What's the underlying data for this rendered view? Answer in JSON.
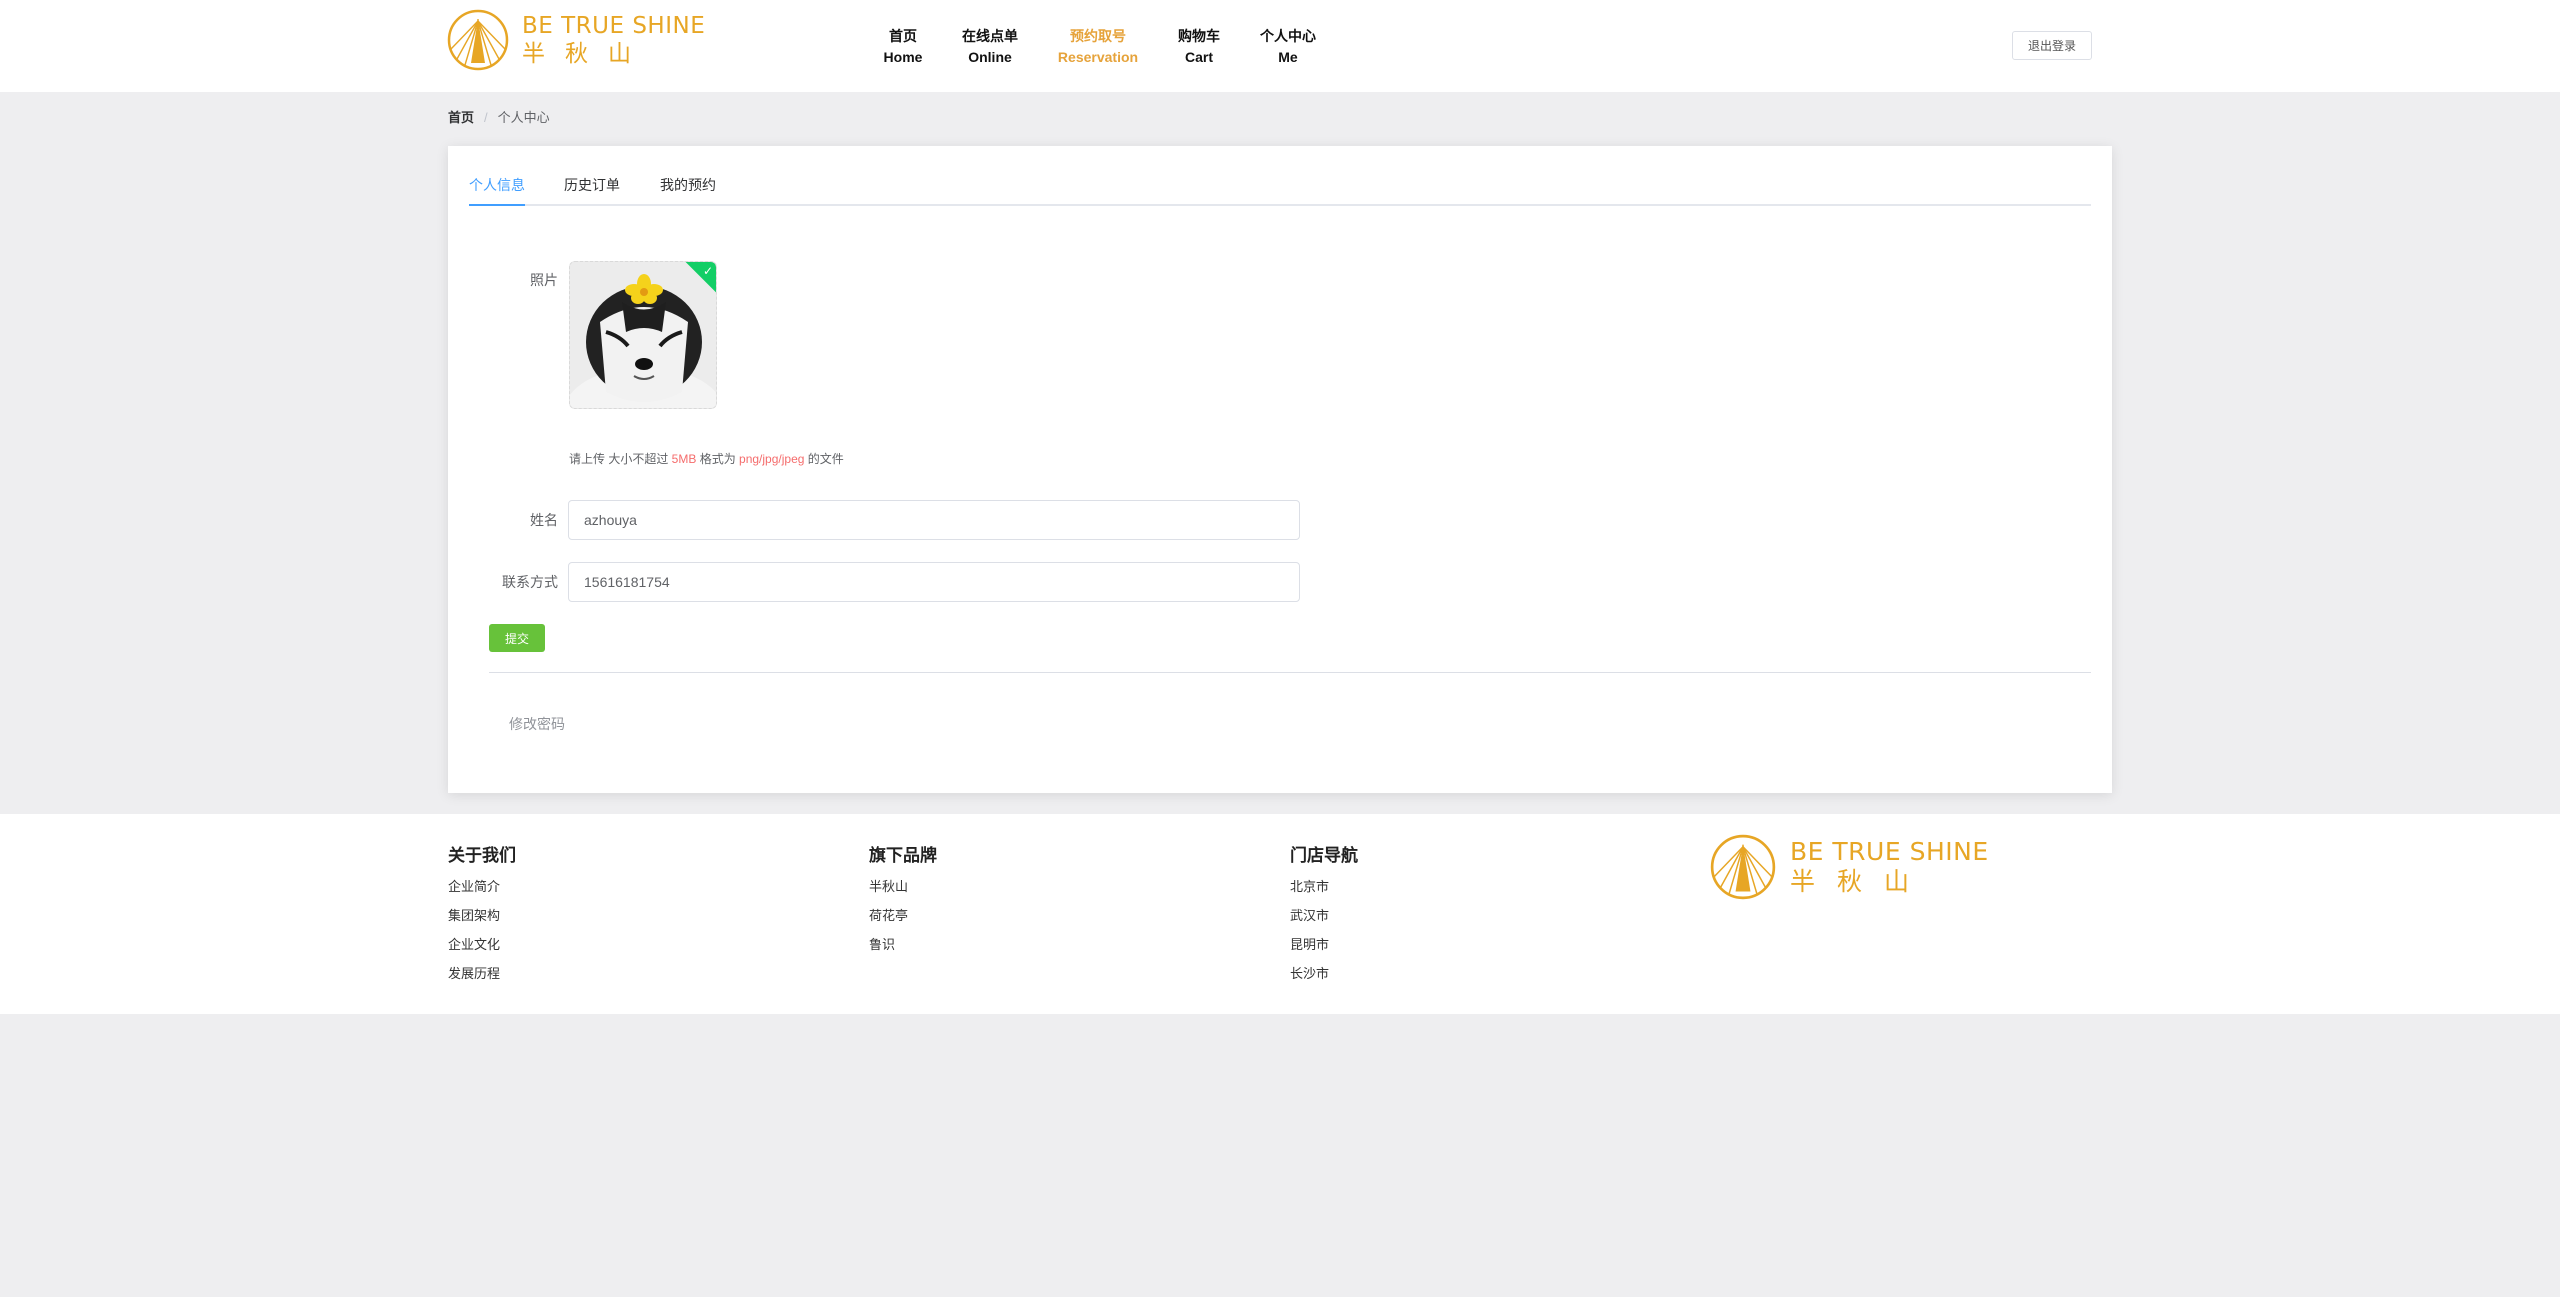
{
  "brand": {
    "name_en": "BE TRUE SHINE",
    "name_cn": "半秋山",
    "color": "#e7a625"
  },
  "nav": {
    "items": [
      {
        "cn": "首页",
        "en": "Home",
        "active": false
      },
      {
        "cn": "在线点单",
        "en": "Online",
        "active": false
      },
      {
        "cn": "预约取号",
        "en": "Reservation",
        "active": true
      },
      {
        "cn": "购物车",
        "en": "Cart",
        "active": false
      },
      {
        "cn": "个人中心",
        "en": "Me",
        "active": false
      }
    ],
    "active_color": "#e6a33b"
  },
  "header": {
    "logout_label": "退出登录"
  },
  "breadcrumb": {
    "home": "首页",
    "separator": "/",
    "current": "个人中心"
  },
  "tabs": [
    {
      "label": "个人信息",
      "active": true
    },
    {
      "label": "历史订单",
      "active": false
    },
    {
      "label": "我的预约",
      "active": false
    }
  ],
  "form": {
    "photo_label": "照片",
    "upload_tip": {
      "prefix": "请上传 大小不超过 ",
      "size": "5MB",
      "middle": " 格式为 ",
      "formats": "png/jpg/jpeg",
      "suffix": " 的文件"
    },
    "name_label": "姓名",
    "name_value": "azhouya",
    "contact_label": "联系方式",
    "contact_value": "15616181754",
    "submit_label": "提交",
    "change_password_label": "修改密码"
  },
  "footer": {
    "columns": [
      {
        "title": "关于我们",
        "links": [
          "企业简介",
          "集团架构",
          "企业文化",
          "发展历程"
        ]
      },
      {
        "title": "旗下品牌",
        "links": [
          "半秋山",
          "荷花亭",
          "鲁识"
        ]
      },
      {
        "title": "门店导航",
        "links": [
          "北京市",
          "武汉市",
          "昆明市",
          "长沙市"
        ]
      }
    ]
  },
  "icons": {
    "logo": "sun-logo-icon",
    "upload_success": "check-icon",
    "avatar": "husky-dog-photo"
  }
}
